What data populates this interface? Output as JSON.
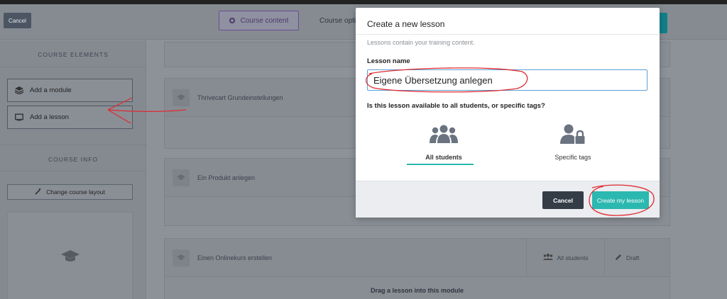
{
  "topbar": {
    "cancel_label": "Cancel",
    "tab_content": "Course content",
    "tab_options": "Course optio"
  },
  "sidebar": {
    "course_elements_title": "COURSE ELEMENTS",
    "add_module_label": "Add a module",
    "add_lesson_label": "Add a lesson",
    "course_info_title": "COURSE INFO",
    "change_layout_label": "Change course layout"
  },
  "modules": [
    {
      "title": "Thrivecart Grundeinstellungen"
    },
    {
      "title": "Ein Produkt anlegen"
    },
    {
      "title": "Einen Onlinekurs erstellen",
      "audience": "All students",
      "status": "Draft",
      "drag_hint": "Drag a lesson into this module"
    }
  ],
  "modal": {
    "title": "Create a new lesson",
    "subtitle": "Lessons contain your training content.",
    "lesson_name_label": "Lesson name",
    "lesson_name_value": "Eigene Übersetzung anlegen",
    "question": "Is this lesson available to all students, or specific tags?",
    "option_all": "All students",
    "option_tags": "Specific tags",
    "cancel_label": "Cancel",
    "create_label": "Create my lesson"
  },
  "colors": {
    "accent_teal": "#2bb8b0",
    "annotation_red": "#e0292f",
    "dark_button": "#343c46"
  }
}
